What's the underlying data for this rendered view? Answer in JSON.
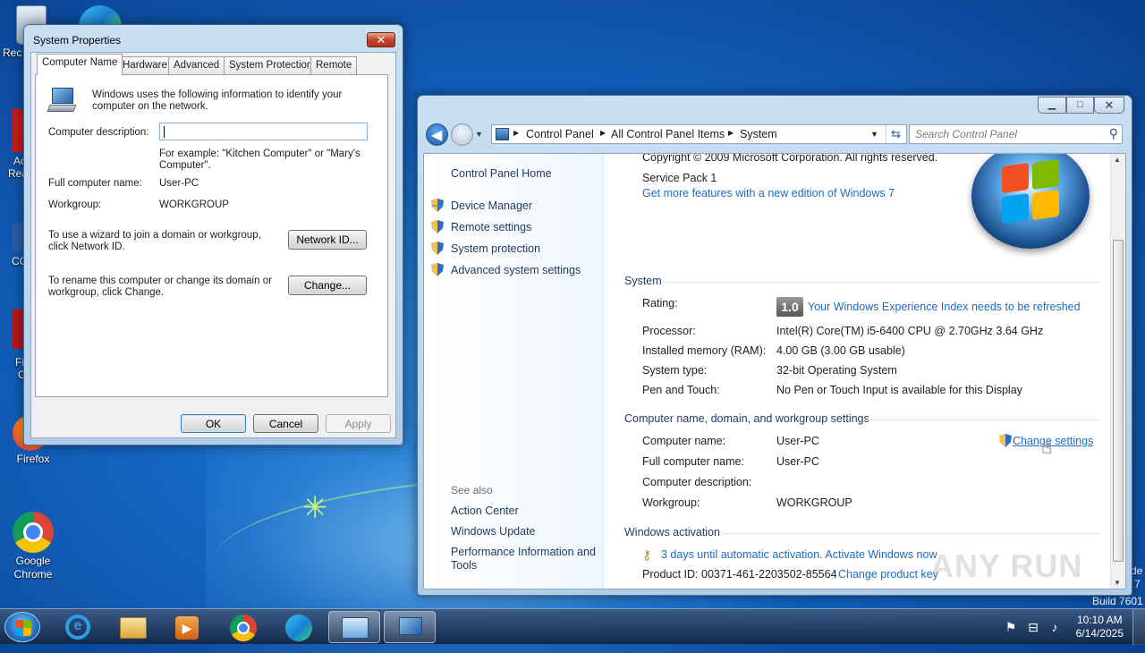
{
  "desktop": {
    "icons": [
      {
        "label": "Rec",
        "kind": "recycle"
      },
      {
        "label": "Firefox",
        "kind": "firefox"
      },
      {
        "label": "Google Chrome",
        "kind": "chrome"
      }
    ],
    "partial_labels": [
      "Ac",
      "Rea",
      "CC",
      "Fi",
      "C"
    ],
    "watermark": "ANY RUN",
    "os_text": {
      "line1": "de",
      "line2": "7",
      "build": "Build 7601"
    }
  },
  "system_properties": {
    "title": "System Properties",
    "close_glyph": "✕",
    "tabs": [
      "Computer Name",
      "Hardware",
      "Advanced",
      "System Protection",
      "Remote"
    ],
    "intro": "Windows uses the following information to identify your computer on the network.",
    "description_label": "Computer description:",
    "description_value": "",
    "example": "For example: \"Kitchen Computer\" or \"Mary's Computer\".",
    "full_name_label": "Full computer name:",
    "full_name_value": "User-PC",
    "workgroup_label": "Workgroup:",
    "workgroup_value": "WORKGROUP",
    "wizard_text": "To use a wizard to join a domain or workgroup, click Network ID.",
    "network_id_button": "Network ID...",
    "rename_text": "To rename this computer or change its domain or workgroup, click Change.",
    "change_button": "Change...",
    "ok": "OK",
    "cancel": "Cancel",
    "apply": "Apply"
  },
  "control_panel": {
    "caption": {
      "minimize": "▁",
      "maximize": "□",
      "close": "✕"
    },
    "breadcrumb": [
      "Control Panel",
      "All Control Panel Items",
      "System"
    ],
    "search_placeholder": "Search Control Panel",
    "left": {
      "home": "Control Panel Home",
      "links": [
        "Device Manager",
        "Remote settings",
        "System protection",
        "Advanced system settings"
      ],
      "see_also_header": "See also",
      "see_also": [
        "Action Center",
        "Windows Update",
        "Performance Information and Tools"
      ]
    },
    "edition": {
      "copyright": "Copyright © 2009 Microsoft Corporation.  All rights reserved.",
      "service_pack": "Service Pack 1",
      "more_features": "Get more features with a new edition of Windows 7"
    },
    "system": {
      "header": "System",
      "rating_label": "Rating:",
      "rating_score": "1.0",
      "rating_link": "Your Windows Experience Index needs to be refreshed",
      "processor_label": "Processor:",
      "processor_value": "Intel(R) Core(TM) i5-6400 CPU @ 2.70GHz   3.64 GHz",
      "memory_label": "Installed memory (RAM):",
      "memory_value": "4.00 GB (3.00 GB usable)",
      "type_label": "System type:",
      "type_value": "32-bit Operating System",
      "pen_label": "Pen and Touch:",
      "pen_value": "No Pen or Touch Input is available for this Display"
    },
    "computer_name": {
      "header": "Computer name, domain, and workgroup settings",
      "name_label": "Computer name:",
      "name_value": "User-PC",
      "full_label": "Full computer name:",
      "full_value": "User-PC",
      "desc_label": "Computer description:",
      "desc_value": "",
      "workgroup_label": "Workgroup:",
      "workgroup_value": "WORKGROUP",
      "change_settings": "Change settings"
    },
    "activation": {
      "header": "Windows activation",
      "status": "3 days until automatic activation. Activate Windows now",
      "product_id": "Product ID: 00371-461-2203502-85564",
      "change_key": "Change product key"
    }
  },
  "taskbar": {
    "items": [
      "Internet Explorer",
      "Windows Explorer",
      "Windows Media Player",
      "Google Chrome",
      "Microsoft Edge",
      "Control Panel",
      "System Properties"
    ],
    "time": "10:10 AM",
    "date": "6/14/2025"
  }
}
